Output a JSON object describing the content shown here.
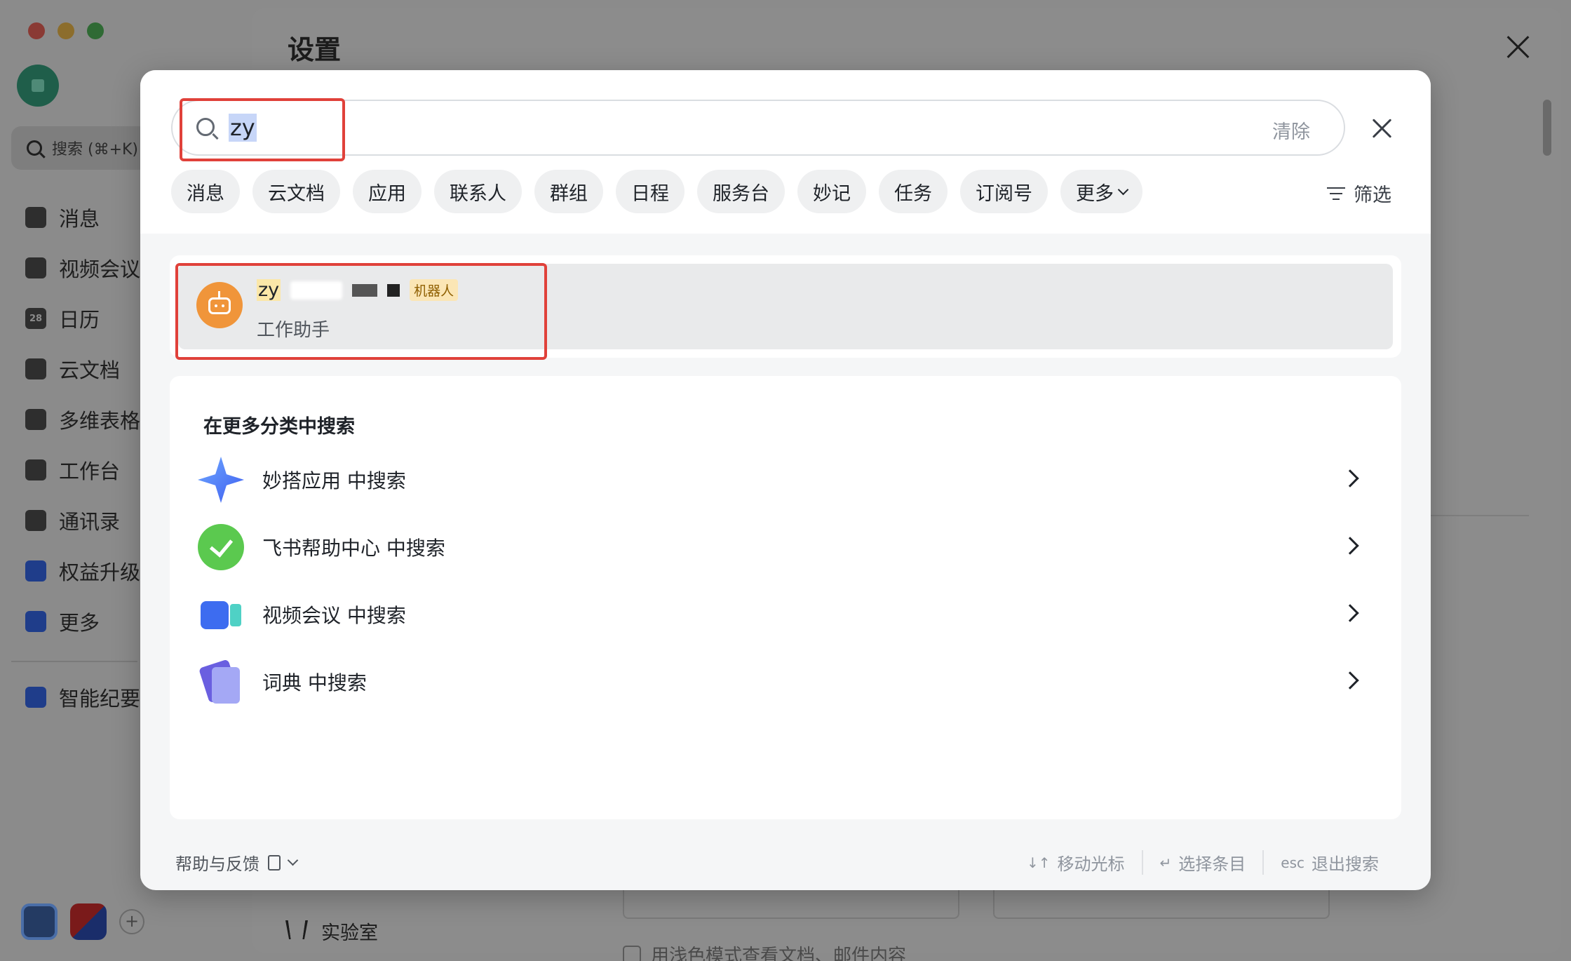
{
  "background": {
    "sidebar": {
      "search_label": "搜索 (⌘+K)",
      "items": [
        {
          "label": "消息",
          "icon": "chat-icon"
        },
        {
          "label": "视频会议",
          "icon": "video-icon"
        },
        {
          "label": "日历",
          "icon": "calendar-icon",
          "glyph": "28"
        },
        {
          "label": "云文档",
          "icon": "docs-icon"
        },
        {
          "label": "多维表格",
          "icon": "base-icon"
        },
        {
          "label": "工作台",
          "icon": "workplace-icon"
        },
        {
          "label": "通讯录",
          "icon": "contacts-icon"
        },
        {
          "label": "权益升级",
          "icon": "diamond-icon"
        },
        {
          "label": "更多",
          "icon": "more-apps-icon"
        }
      ],
      "pinned": {
        "label": "智能纪要",
        "icon": "notes-icon"
      },
      "dock_plus": "+"
    },
    "settings": {
      "title": "设置",
      "lab_label": "实验室",
      "bottom_option": "用浅色模式查看文档、邮件内容"
    }
  },
  "search": {
    "query": "zy",
    "clear_label": "清除",
    "tabs": [
      "消息",
      "云文档",
      "应用",
      "联系人",
      "群组",
      "日程",
      "服务台",
      "妙记",
      "任务",
      "订阅号"
    ],
    "more_tab": "更多",
    "filter_label": "筛选"
  },
  "result": {
    "name": "zy",
    "badge": "机器人",
    "description": "工作助手"
  },
  "more_search": {
    "title": "在更多分类中搜索",
    "items": [
      {
        "label": "妙搭应用 中搜索",
        "icon": "miaoda-app-icon"
      },
      {
        "label": "飞书帮助中心 中搜索",
        "icon": "help-center-icon"
      },
      {
        "label": "视频会议 中搜索",
        "icon": "video-meeting-icon"
      },
      {
        "label": "词典 中搜索",
        "icon": "dictionary-icon"
      }
    ]
  },
  "footer": {
    "help_label": "帮助与反馈",
    "hints": [
      {
        "key": "↓↑",
        "label": "移动光标"
      },
      {
        "key": "↵",
        "label": "选择条目"
      },
      {
        "key": "esc",
        "label": "退出搜索"
      }
    ]
  },
  "colors": {
    "highlight_border": "#e0413a",
    "selection": "#c7d6f8",
    "bot_avatar": "#f0953a",
    "badge_bg": "#fbe6b5"
  }
}
